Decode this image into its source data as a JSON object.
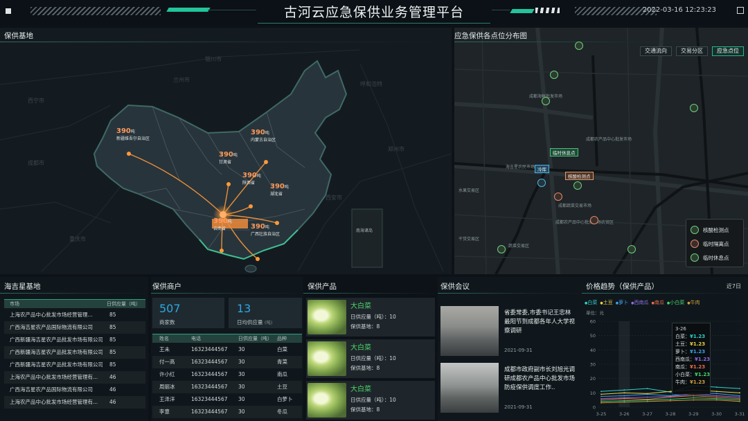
{
  "header": {
    "title": "古河云应急保供业务管理平台",
    "datetime": "2022-03-16 12:23:23"
  },
  "supply_base": {
    "title": "保供基地",
    "inset_label": "南海诸岛",
    "markers": [
      {
        "value": "390",
        "unit": "吨",
        "label": "新疆维吾尔自治区"
      },
      {
        "value": "390",
        "unit": "吨",
        "label": "内蒙古自治区"
      },
      {
        "value": "390",
        "unit": "吨",
        "label": "甘肃省"
      },
      {
        "value": "390",
        "unit": "吨",
        "label": "陕西省"
      },
      {
        "value": "390",
        "unit": "吨",
        "label": "湖北省"
      },
      {
        "value": "390",
        "unit": "吨",
        "label": "云南省"
      },
      {
        "value": "390",
        "unit": "吨",
        "label": "广西壮族自治区"
      }
    ],
    "bg_labels": [
      "西宁市",
      "兰州市",
      "银川市",
      "呼和浩特",
      "成都市",
      "重庆市",
      "西安市",
      "郑州市"
    ]
  },
  "distribution": {
    "title": "应急保供各点位分布图",
    "buttons": [
      "交通流向",
      "交易分区",
      "应急点位"
    ],
    "active_button": "应急点位",
    "callouts": [
      "临时休息点",
      "冷库",
      "核酸检测点"
    ],
    "street_labels": [
      "成都海鲜批发市场",
      "成都农产品中心批发市场",
      "成都蔬菜交易市场",
      "海吉星农民市场",
      "水果交易区",
      "蔬菜交易区",
      "成都农产品中心批发市场农贸区",
      "干货交易区"
    ],
    "legend": [
      {
        "icon": "test-point-icon",
        "label": "核酸检测点"
      },
      {
        "icon": "isolation-point-icon",
        "label": "临时隔离点"
      },
      {
        "icon": "rest-point-icon",
        "label": "临时休息点"
      }
    ]
  },
  "haijixing": {
    "title": "海吉星基地",
    "columns": [
      "市场",
      "日供应量（吨）"
    ],
    "rows": [
      {
        "name": "上海农产品中心批发市场经营管理...",
        "value": "85"
      },
      {
        "name": "广西海吉星农产品国际物流有限公司",
        "value": "85"
      },
      {
        "name": "广西新疆海吉星农产品批发市场有限公司",
        "value": "85"
      },
      {
        "name": "广西新疆海吉星农产品批发市场有限公司",
        "value": "85"
      },
      {
        "name": "广西新疆海吉星农产品批发市场有限公司",
        "value": "85"
      },
      {
        "name": "上海农产品中心批发市场经营管理有...",
        "value": "46"
      },
      {
        "name": "广西海吉星农产品国际物流有限公司",
        "value": "46"
      },
      {
        "name": "上海农产品中心批发市场经营管理有...",
        "value": "46"
      }
    ]
  },
  "merchants": {
    "title": "保供商户",
    "stat1": {
      "value": "507",
      "label": "商家数"
    },
    "stat2": {
      "value": "13",
      "label": "日均供应量",
      "unit": "(吨)"
    },
    "columns": [
      "姓名",
      "电话",
      "日供应量（吨）",
      "品种"
    ],
    "rows": [
      {
        "name": "王未",
        "phone": "16323444567",
        "qty": "30",
        "kind": "白菜"
      },
      {
        "name": "付一高",
        "phone": "16323444567",
        "qty": "30",
        "kind": "青菜"
      },
      {
        "name": "许小红",
        "phone": "16323444567",
        "qty": "30",
        "kind": "南瓜"
      },
      {
        "name": "周丽冰",
        "phone": "16323444567",
        "qty": "30",
        "kind": "土豆"
      },
      {
        "name": "王泽洋",
        "phone": "16323444567",
        "qty": "30",
        "kind": "白萝卜"
      },
      {
        "name": "李意",
        "phone": "16323444567",
        "qty": "30",
        "kind": "冬瓜"
      }
    ]
  },
  "products": {
    "title": "保供产品",
    "items": [
      {
        "name": "大白菜",
        "supply": "日供应量（吨）：10",
        "bases": "保供基地：8"
      },
      {
        "name": "大白菜",
        "supply": "日供应量（吨）：10",
        "bases": "保供基地：8"
      },
      {
        "name": "大白菜",
        "supply": "日供应量（吨）：10",
        "bases": "保供基地：8"
      }
    ]
  },
  "meetings": {
    "title": "保供会议",
    "items": [
      {
        "text": "省委常委,市委书记王忠林最阳节到成都各年人大学视察调研",
        "date": "2021-09-31"
      },
      {
        "text": "成都市政府副市长刘旭光调研成都农产品中心批发市场防疫保供调度工作..",
        "date": "2021-09-31"
      }
    ]
  },
  "price_trend": {
    "title": "价格趋势（保供产品）",
    "period": "近7日",
    "tooltip": {
      "date": "3-26",
      "rows": [
        {
          "name": "白菜",
          "value": "¥1.23"
        },
        {
          "name": "土豆",
          "value": "¥1.23"
        },
        {
          "name": "萝卜",
          "value": "¥1.23"
        },
        {
          "name": "西南瓜",
          "value": "¥1.23"
        },
        {
          "name": "南瓜",
          "value": "¥1.23"
        },
        {
          "name": "小白菜",
          "value": "¥1.23"
        },
        {
          "name": "牛肉",
          "value": "¥1.23"
        }
      ]
    }
  },
  "chart_data": {
    "type": "line",
    "ylabel": "单位：元",
    "ylim": [
      0,
      60
    ],
    "yticks": [
      0,
      10,
      20,
      30,
      40,
      50,
      60
    ],
    "x": [
      "3-25",
      "3-26",
      "3-27",
      "3-28",
      "3-29",
      "3-30",
      "3-31"
    ],
    "grid": true,
    "legend_position": "top",
    "series": [
      {
        "name": "白菜",
        "color": "#2fd0c8",
        "values": [
          11,
          12,
          13,
          10.5,
          15,
          14,
          13
        ]
      },
      {
        "name": "土豆",
        "color": "#e8d048",
        "values": [
          9,
          10,
          9.5,
          11,
          12,
          11,
          10
        ]
      },
      {
        "name": "萝卜",
        "color": "#3fa0e8",
        "values": [
          7.5,
          8,
          9,
          8,
          10,
          9.5,
          8
        ]
      },
      {
        "name": "西南瓜",
        "color": "#8a70e0",
        "values": [
          6,
          6.5,
          7,
          7.5,
          9,
          8,
          7
        ]
      },
      {
        "name": "南瓜",
        "color": "#e86f4a",
        "values": [
          5,
          6,
          5.5,
          7,
          8,
          7,
          6
        ]
      },
      {
        "name": "小白菜",
        "color": "#46d46a",
        "values": [
          4,
          4.5,
          5,
          5.5,
          6.5,
          6,
          5
        ]
      },
      {
        "name": "牛肉",
        "color": "#d0a040",
        "values": [
          3,
          3.5,
          4,
          4.5,
          5,
          5,
          4
        ]
      }
    ]
  }
}
